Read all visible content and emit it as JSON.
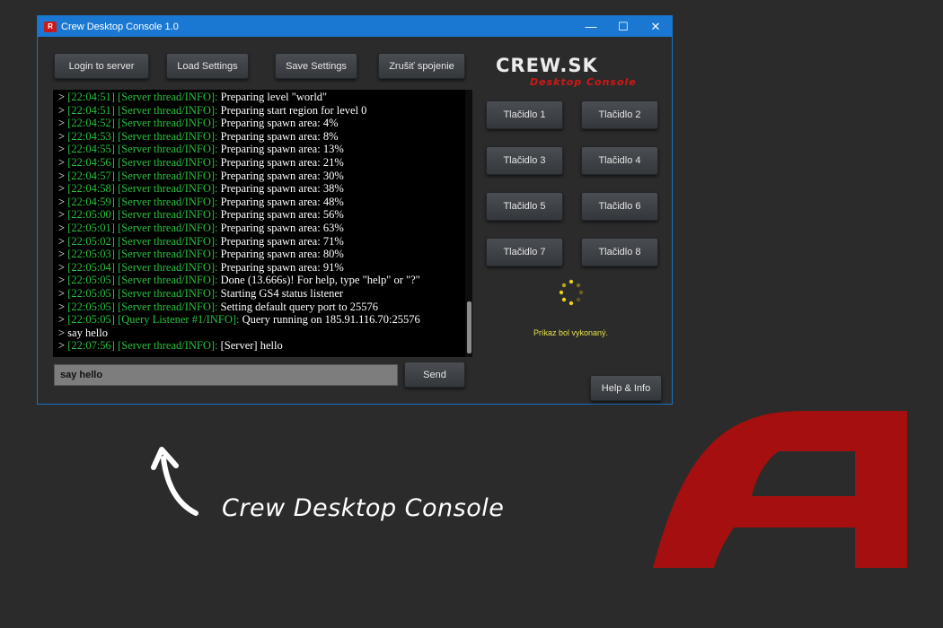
{
  "window": {
    "title": "Crew Desktop Console 1.0",
    "app_icon_letter": "R"
  },
  "controls": {
    "minimize": "—",
    "maximize": "☐",
    "close": "✕"
  },
  "toolbar": {
    "login": "Login to server",
    "load": "Load Settings",
    "save": "Save Settings",
    "cancel": "Zrušiť spojenie"
  },
  "logo": {
    "main": "CREW.SK",
    "sub": "Desktop Console"
  },
  "console_lines": [
    {
      "ts": "> [22:04:51]",
      "src": "[Server thread/INFO]:",
      "msg": " Preparing level \"world\""
    },
    {
      "ts": "> [22:04:51]",
      "src": "[Server thread/INFO]:",
      "msg": " Preparing start region for level 0"
    },
    {
      "ts": "> [22:04:52]",
      "src": "[Server thread/INFO]:",
      "msg": " Preparing spawn area: 4%"
    },
    {
      "ts": "> [22:04:53]",
      "src": "[Server thread/INFO]:",
      "msg": " Preparing spawn area: 8%"
    },
    {
      "ts": "> [22:04:55]",
      "src": "[Server thread/INFO]:",
      "msg": " Preparing spawn area: 13%"
    },
    {
      "ts": "> [22:04:56]",
      "src": "[Server thread/INFO]:",
      "msg": " Preparing spawn area: 21%"
    },
    {
      "ts": "> [22:04:57]",
      "src": "[Server thread/INFO]:",
      "msg": " Preparing spawn area: 30%"
    },
    {
      "ts": "> [22:04:58]",
      "src": "[Server thread/INFO]:",
      "msg": " Preparing spawn area: 38%"
    },
    {
      "ts": "> [22:04:59]",
      "src": "[Server thread/INFO]:",
      "msg": " Preparing spawn area: 48%"
    },
    {
      "ts": "> [22:05:00]",
      "src": "[Server thread/INFO]:",
      "msg": " Preparing spawn area: 56%"
    },
    {
      "ts": "> [22:05:01]",
      "src": "[Server thread/INFO]:",
      "msg": " Preparing spawn area: 63%"
    },
    {
      "ts": "> [22:05:02]",
      "src": "[Server thread/INFO]:",
      "msg": " Preparing spawn area: 71%"
    },
    {
      "ts": "> [22:05:03]",
      "src": "[Server thread/INFO]:",
      "msg": " Preparing spawn area: 80%"
    },
    {
      "ts": "> [22:05:04]",
      "src": "[Server thread/INFO]:",
      "msg": " Preparing spawn area: 91%"
    },
    {
      "ts": "> [22:05:05]",
      "src": "[Server thread/INFO]:",
      "msg": " Done (13.666s)! For help, type \"help\" or \"?\""
    },
    {
      "ts": "> [22:05:05]",
      "src": "[Server thread/INFO]:",
      "msg": " Starting GS4 status listener"
    },
    {
      "ts": "> [22:05:05]",
      "src": "[Server thread/INFO]:",
      "msg": " Setting default query port to 25576"
    },
    {
      "ts": "> [22:05:05]",
      "src": "[Query Listener #1/INFO]:",
      "msg": " Query running on 185.91.116.70:25576"
    },
    {
      "ts": "> say hello",
      "src": "",
      "msg": ""
    },
    {
      "ts": "> [22:07:56]",
      "src": "[Server thread/INFO]:",
      "msg": " [Server] hello"
    }
  ],
  "input": {
    "value": "say hello"
  },
  "send_label": "Send",
  "quick_buttons": [
    "Tlačidlo 1",
    "Tlačidlo 2",
    "Tlačidlo 3",
    "Tlačidlo 4",
    "Tlačidlo 5",
    "Tlačidlo 6",
    "Tlačidlo 7",
    "Tlačidlo 8"
  ],
  "status_text": "Príkaz bol vykonaný.",
  "help_label": "Help & Info",
  "caption": "Crew Desktop Console",
  "colors": {
    "titlebar": "#1a78d2",
    "console_green": "#27c23c",
    "brand_red": "#c81a1a",
    "status_yellow": "#e8e14a"
  }
}
